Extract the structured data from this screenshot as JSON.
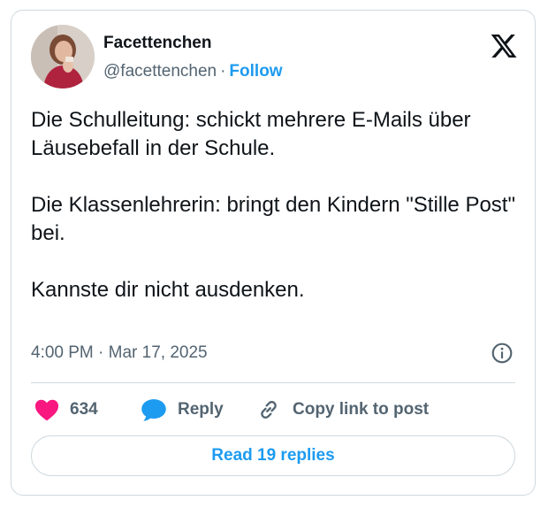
{
  "author": {
    "name": "Facettenchen",
    "handle": "@facettenchen",
    "separator": "·",
    "follow_label": "Follow"
  },
  "tweet": {
    "paragraphs": [
      "Die Schulleitung: schickt mehrere E-Mails über Läusebefall in der Schule.",
      "Die Klassenlehrerin: bringt den Kindern \"Stille Post\" bei.",
      "Kannste dir nicht ausdenken."
    ],
    "time": "4:00 PM",
    "date": "Mar 17, 2025",
    "meta_separator": "·"
  },
  "actions": {
    "like_count": "634",
    "reply_label": "Reply",
    "copy_label": "Copy link to post"
  },
  "read_replies_label": "Read 19 replies",
  "icons": {
    "logo": "x-logo-icon",
    "info": "info-icon",
    "like": "heart-icon",
    "reply": "speech-bubble-icon",
    "copy": "link-icon"
  },
  "colors": {
    "accent": "#1d9bf0",
    "like": "#f91880",
    "text": "#0f1419",
    "secondary": "#536471",
    "border": "#cfd9de"
  }
}
